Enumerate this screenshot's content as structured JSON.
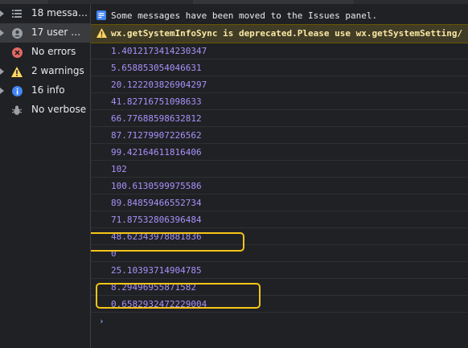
{
  "sidebar": {
    "items": [
      {
        "label": "18 messages",
        "icon": "list-icon",
        "has_arrow": true
      },
      {
        "label": "17 user mes...",
        "icon": "user-icon",
        "has_arrow": true
      },
      {
        "label": "No errors",
        "icon": "error-icon",
        "has_arrow": false
      },
      {
        "label": "2 warnings",
        "icon": "warning-icon",
        "has_arrow": true
      },
      {
        "label": "16 info",
        "icon": "info-icon",
        "has_arrow": true
      },
      {
        "label": "No verbose",
        "icon": "bug-icon",
        "has_arrow": false
      }
    ]
  },
  "console": {
    "notice": "Some messages have been moved to the Issues panel.",
    "warning": "wx.getSystemInfoSync is deprecated.Please use wx.getSystemSetting/",
    "logs": [
      "1.4012173414230347",
      "5.658853054046631",
      "20.122203826904297",
      "41.82716751098633",
      "66.77688598632812",
      "87.71279907226562",
      "99.42164611816406",
      "102",
      "100.6130599975586",
      "89.84859466552734",
      "71.87532806396484",
      "48.62343978881836",
      "0",
      "25.10393714904785",
      "8.29496955871582",
      "0.6582932472229004"
    ],
    "prompt": "›"
  },
  "colors": {
    "background": "#202124",
    "log_value": "#a991fc",
    "warning_bg": "#413c26",
    "highlight": "#f5c518"
  }
}
